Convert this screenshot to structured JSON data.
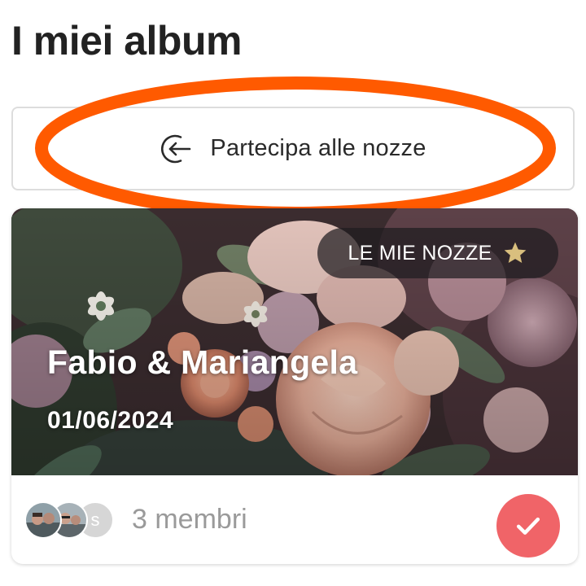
{
  "header": {
    "title": "I miei album"
  },
  "join": {
    "label": "Partecipa alle nozze",
    "icon": "login-arrow-icon"
  },
  "highlight": {
    "color": "#ff5a00"
  },
  "album": {
    "badge": {
      "label": "LE MIE NOZZE",
      "icon": "star-icon",
      "star_color": "#d9bf7e"
    },
    "couple_name": "Fabio & Mariangela",
    "date": "01/06/2024",
    "avatars": [
      {
        "kind": "photo"
      },
      {
        "kind": "photo"
      },
      {
        "kind": "initial",
        "initial": "s"
      }
    ],
    "members": "3 membri",
    "check": {
      "icon": "check-icon",
      "color": "#f06468"
    }
  }
}
